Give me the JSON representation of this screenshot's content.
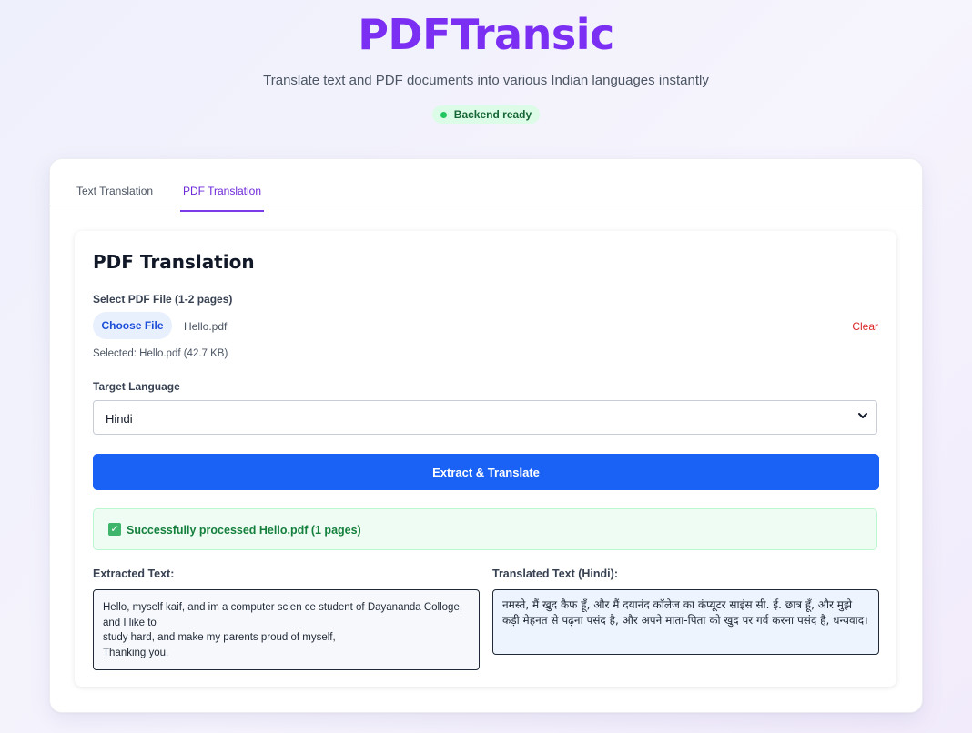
{
  "header": {
    "title": "PDFTransic",
    "subtitle": "Translate text and PDF documents into various Indian languages instantly",
    "status": "Backend ready"
  },
  "tabs": [
    {
      "label": "Text Translation",
      "active": false
    },
    {
      "label": "PDF Translation",
      "active": true
    }
  ],
  "panel": {
    "title": "PDF Translation",
    "file_label": "Select PDF File (1-2 pages)",
    "choose_file_label": "Choose File",
    "file_name": "Hello.pdf",
    "clear_label": "Clear",
    "selected_info": "Selected: Hello.pdf (42.7 KB)",
    "language_label": "Target Language",
    "language_value": "Hindi",
    "translate_button": "Extract & Translate",
    "success_message": "Successfully processed Hello.pdf (1 pages)",
    "extracted_label": "Extracted Text:",
    "translated_label": "Translated Text (Hindi):",
    "extracted_text": "Hello, myself kaif, and im a computer  scien ce student of Dayananda Colloge, and I like to\nstudy hard, and make my parents proud of myself,\nThanking you.",
    "translated_text": "नमस्ते, मैं खुद कैफ हूँ, और मैं दयानंद कॉलेज का कंप्यूटर साइंस सी. ई. छात्र हूँ, और मुझे कड़ी मेहनत से पढ़ना पसंद है, और अपने माता-पिता को खुद पर गर्व करना पसंद है, धन्यवाद।"
  },
  "colors": {
    "brand": "#7b2ff2",
    "primary_button": "#1a62f5",
    "success": "#15803d",
    "danger": "#dc2626"
  }
}
